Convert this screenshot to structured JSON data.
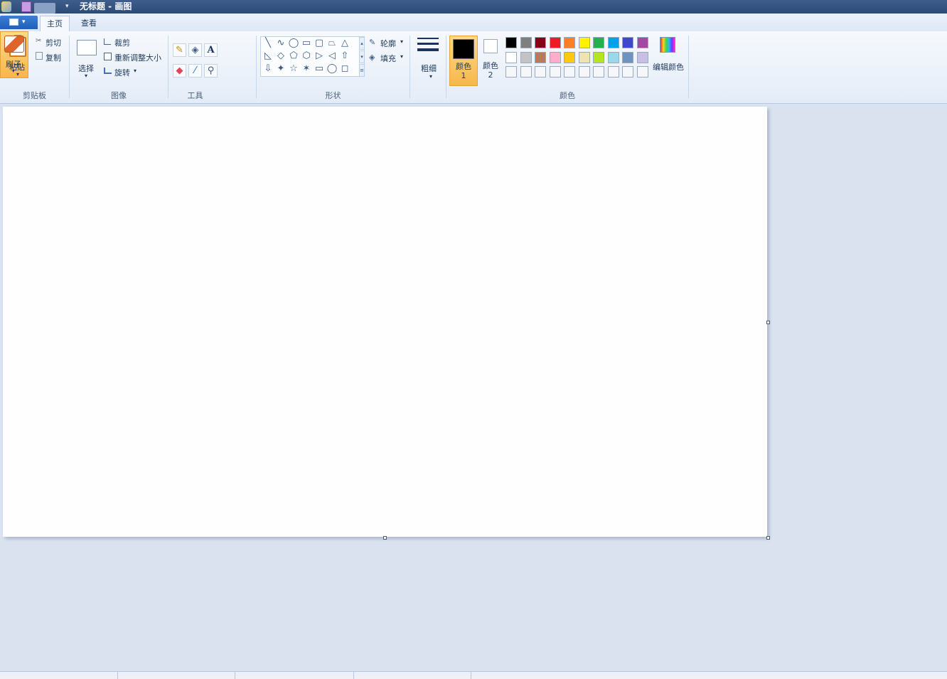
{
  "window": {
    "title": "无标题 - 画图"
  },
  "file_menu": {
    "icon": "file-menu-icon",
    "arrow": "▾"
  },
  "qat": {
    "dropdown": "▾"
  },
  "tabs": [
    {
      "label": "主页",
      "active": true
    },
    {
      "label": "查看",
      "active": false
    }
  ],
  "ribbon": {
    "clipboard": {
      "label": "剪贴板",
      "paste": "粘贴",
      "cut": "剪切",
      "copy": "复制"
    },
    "image": {
      "label": "图像",
      "select": "选择",
      "crop": "裁剪",
      "resize": "重新调整大小",
      "rotate": "旋转",
      "rotate_arrow": "▾"
    },
    "tools": {
      "label": "工具",
      "pencil": "✎",
      "fill": "◈",
      "text": "A",
      "eraser": "◆",
      "picker": "⁄",
      "magnifier": "⚲"
    },
    "brushes": {
      "label": "刷子"
    },
    "shapes": {
      "label": "形状",
      "row1": [
        "╲",
        "∿",
        "◯",
        "▭",
        "▢",
        "⏢",
        "△"
      ],
      "row2": [
        "◺",
        "◇",
        "⬠",
        "⬡",
        "▷",
        "◁",
        "⇧"
      ],
      "row3": [
        "⇩",
        "✦",
        "☆",
        "✶",
        "▭",
        "◯",
        "◻"
      ],
      "outline": "轮廓",
      "fill": "填充"
    },
    "size": {
      "label": "粗细"
    },
    "colors": {
      "label": "颜色",
      "color1_label": "颜色 1",
      "color2_label": "颜色 2",
      "color1": "#000000",
      "color2": "#ffffff",
      "edit_colors": "编辑颜色",
      "palette": [
        [
          "#000000",
          "#7f7f7f",
          "#880015",
          "#ed1c24",
          "#ff7f27",
          "#fff200",
          "#22b14c",
          "#00a2e8",
          "#3f48cc",
          "#a349a4"
        ],
        [
          "#ffffff",
          "#c3c3c3",
          "#b97a57",
          "#ffaec9",
          "#ffc90e",
          "#efe4b0",
          "#b5e61d",
          "#99d9ea",
          "#7092be",
          "#c8bfe7"
        ],
        [
          "#f5f7fb",
          "#f5f7fb",
          "#f5f7fb",
          "#f5f7fb",
          "#f5f7fb",
          "#f5f7fb",
          "#f5f7fb",
          "#f5f7fb",
          "#f5f7fb",
          "#f5f7fb"
        ]
      ]
    }
  }
}
